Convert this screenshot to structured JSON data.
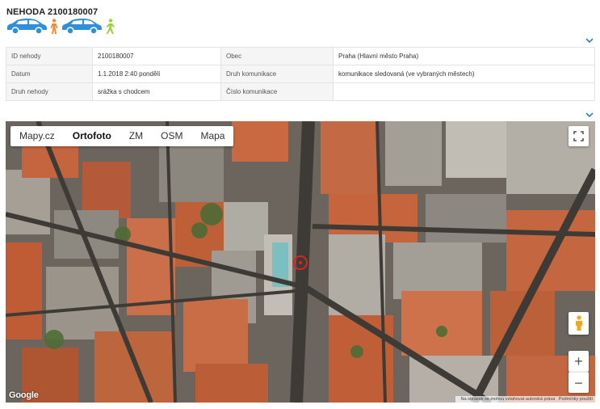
{
  "header": {
    "title": "NEHODA 2100180007"
  },
  "participants": [
    {
      "icon": "car-icon",
      "color": "#2f8fd8"
    },
    {
      "icon": "pedestrian-icon",
      "color": "#f08a2a"
    },
    {
      "icon": "car-icon",
      "color": "#2f8fd8"
    },
    {
      "icon": "pedestrian-icon",
      "color": "#9bd13a"
    }
  ],
  "details": {
    "rows": [
      {
        "label1": "ID nehody",
        "value1": "2100180007",
        "label2": "Obec",
        "value2": "Praha (Hlavní město Praha)"
      },
      {
        "label1": "Datum",
        "value1": "1.1.2018 2:40 pondělí",
        "label2": "Druh komunikace",
        "value2": "komunikace sledovaná (ve vybraných městech)"
      },
      {
        "label1": "Druh nehody",
        "value1": "srážka s chodcem",
        "label2": "Číslo komunikace",
        "value2": ""
      }
    ]
  },
  "map": {
    "tabs": [
      "Mapy.cz",
      "Ortofoto",
      "ZM",
      "OSM",
      "Mapa"
    ],
    "active_tab": "Ortofoto",
    "zoom_in_label": "+",
    "zoom_out_label": "−",
    "logo": "Google",
    "attribution": "Na obrázek se mohou vztahovat autorská práva",
    "terms": "Podmínky použití",
    "marker_color": "#d22222"
  }
}
